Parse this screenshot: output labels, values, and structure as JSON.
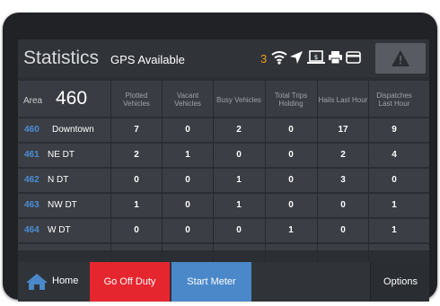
{
  "header": {
    "title": "Statistics",
    "gps_status": "GPS Available",
    "notification_count": "3",
    "icons": [
      "wifi-icon",
      "navigation-arrow-icon",
      "payment-terminal-icon",
      "printer-icon",
      "credit-card-icon"
    ],
    "alert_icon": "warning-triangle-icon"
  },
  "table": {
    "area_label": "Area",
    "area_number": "460",
    "columns": [
      "Plotted Vehicles",
      "Vacant Vehicles",
      "Busy Vehicles",
      "Total Trips Holding",
      "Hails Last Hour",
      "Dispatches Last Hour"
    ],
    "rows": [
      {
        "id": "460",
        "name": "Downtown",
        "values": [
          "7",
          "0",
          "2",
          "0",
          "17",
          "9"
        ]
      },
      {
        "id": "461",
        "name": "NE DT",
        "values": [
          "2",
          "1",
          "0",
          "0",
          "2",
          "4"
        ]
      },
      {
        "id": "462",
        "name": "N DT",
        "values": [
          "0",
          "0",
          "1",
          "0",
          "3",
          "0"
        ]
      },
      {
        "id": "463",
        "name": "NW DT",
        "values": [
          "1",
          "0",
          "1",
          "0",
          "0",
          "1"
        ]
      },
      {
        "id": "464",
        "name": "W DT",
        "values": [
          "0",
          "0",
          "0",
          "1",
          "0",
          "1"
        ]
      }
    ]
  },
  "footer": {
    "home_label": "Home",
    "off_duty_label": "Go Off Duty",
    "start_meter_label": "Start Meter",
    "options_label": "Options"
  },
  "colors": {
    "accent_blue": "#4a88c9",
    "danger_red": "#e5262e",
    "notification_orange": "#f39a1f",
    "area_id_blue": "#4a8fd8"
  }
}
